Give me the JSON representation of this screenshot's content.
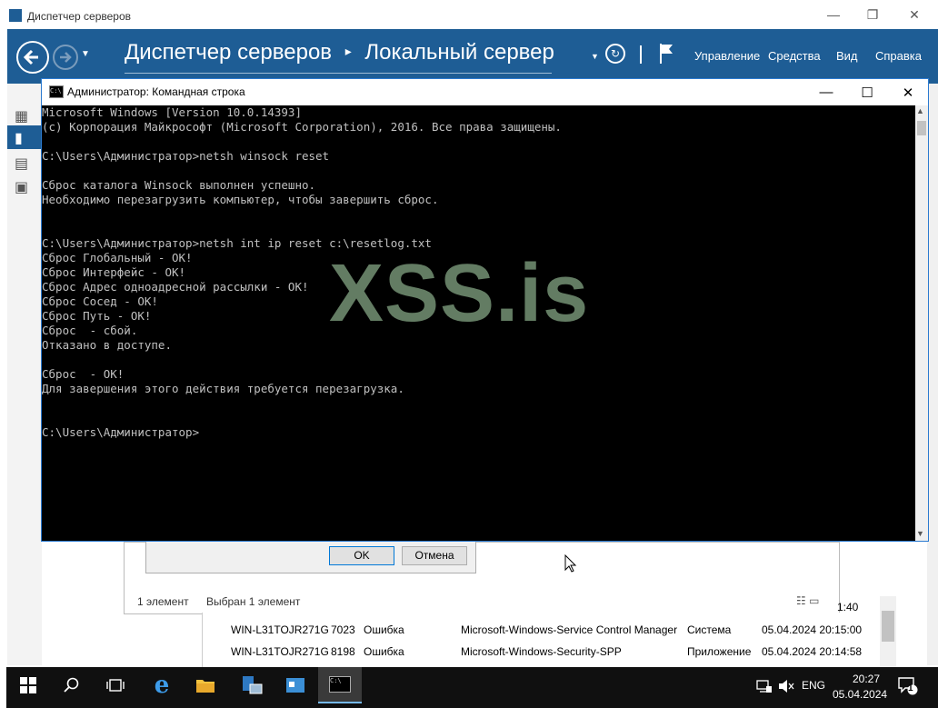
{
  "server_manager": {
    "window_title": "Диспетчер серверов",
    "breadcrumb_root": "Диспетчер серверов",
    "breadcrumb_sep": "▸",
    "breadcrumb_current": "Локальный сервер",
    "menu": [
      "Управление",
      "Средства",
      "Вид",
      "Справка"
    ],
    "colors": {
      "nav_bg": "#1e5d95",
      "accent": "#0078d7"
    }
  },
  "dialog": {
    "ok_label": "OK",
    "cancel_label": "Отмена"
  },
  "status_bar": {
    "count": "1 элемент",
    "selected": "Выбран 1 элемент"
  },
  "events": {
    "partial_time": "1:40",
    "rows": [
      [
        "WIN-L31TOJR271G",
        "7023",
        "Ошибка",
        "Microsoft-Windows-Service Control Manager",
        "Система",
        "05.04.2024 20:15:00"
      ],
      [
        "WIN-L31TOJR271G",
        "8198",
        "Ошибка",
        "Microsoft-Windows-Security-SPP",
        "Приложение",
        "05.04.2024 20:14:58"
      ]
    ]
  },
  "console": {
    "title": "Администратор: Командная строка",
    "lines": [
      "Microsoft Windows [Version 10.0.14393]",
      "(c) Корпорация Майкрософт (Microsoft Corporation), 2016. Все права защищены.",
      "",
      "C:\\Users\\Администратор>netsh winsock reset",
      "",
      "Сброс каталога Winsock выполнен успешно.",
      "Необходимо перезагрузить компьютер, чтобы завершить сброс.",
      "",
      "",
      "C:\\Users\\Администратор>netsh int ip reset c:\\resetlog.txt",
      "Сброс Глобальный - OK!",
      "Сброс Интерфейс - OK!",
      "Сброс Адрес одноадресной рассылки - OK!",
      "Сброс Сосед - OK!",
      "Сброс Путь - OK!",
      "Сброс  - сбой.",
      "Отказано в доступе.",
      "",
      "Сброс  - OK!",
      "Для завершения этого действия требуется перезагрузка.",
      "",
      "",
      "C:\\Users\\Администратор>"
    ]
  },
  "watermark": "XSS.is",
  "taskbar": {
    "language": "ENG",
    "time": "20:27",
    "date": "05.04.2024",
    "notification_count": "1"
  }
}
